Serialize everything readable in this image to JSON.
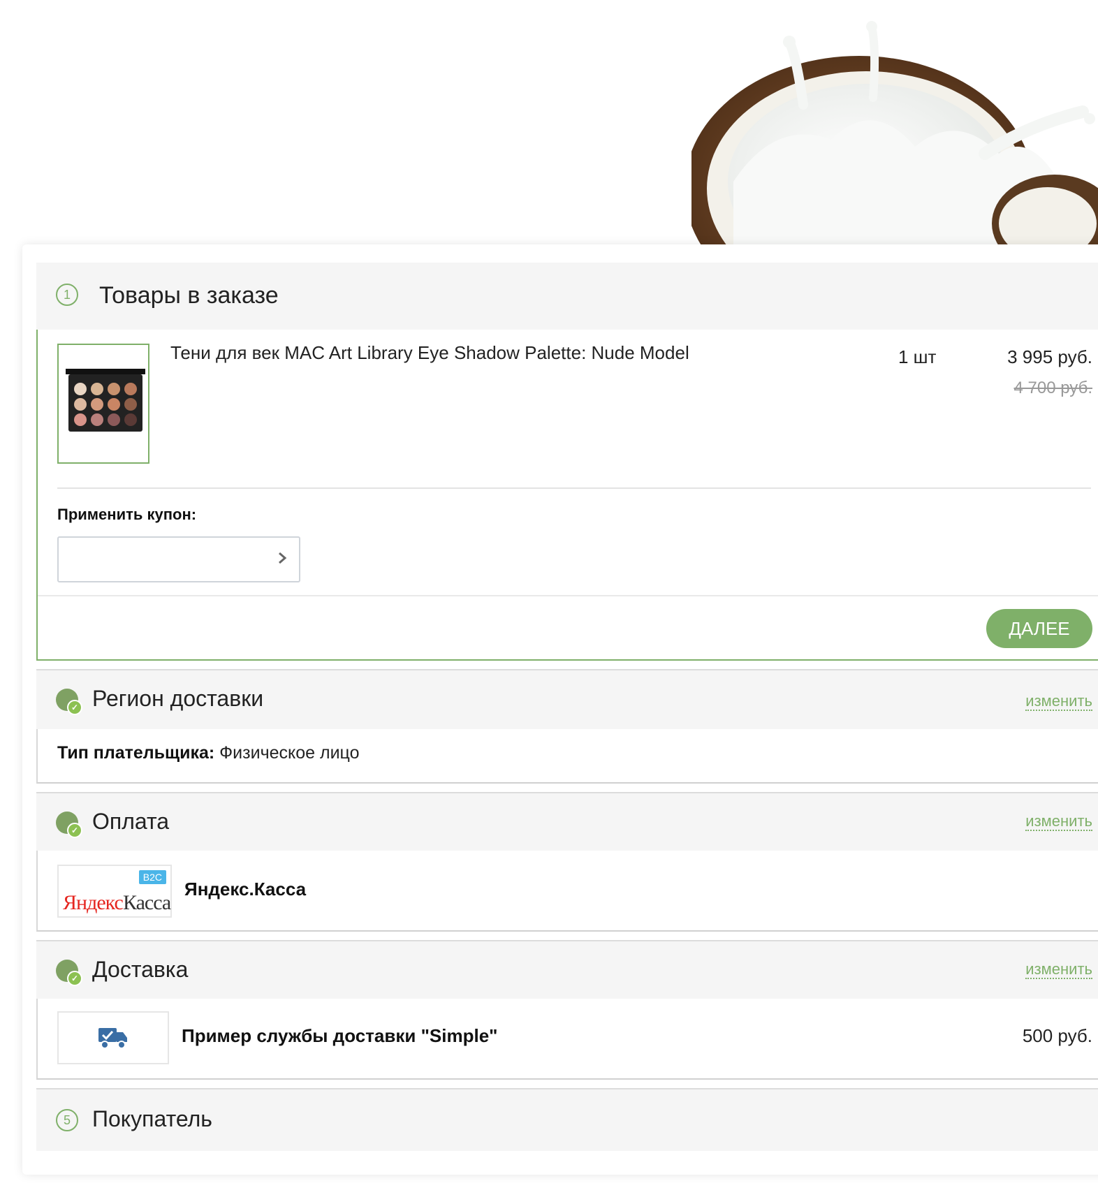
{
  "order_items": {
    "step_number": "1",
    "title": "Товары в заказе",
    "product_name": "Тени для век MAC Art Library Eye Shadow Palette: Nude Model",
    "quantity": "1 шт",
    "price": "3 995 руб.",
    "old_price": "4 700 руб.",
    "coupon_label": "Применить купон:",
    "coupon_value": "",
    "next_button": "ДАЛЕЕ"
  },
  "region": {
    "title": "Регион доставки",
    "change_link": "изменить",
    "payer_label": "Тип плательщика:",
    "payer_value": " Физическое лицо"
  },
  "payment": {
    "title": "Оплата",
    "change_link": "изменить",
    "method_name": "Яндекс.Касса",
    "logo_text_1": "Яндекс",
    "logo_text_2": "Касса",
    "logo_badge": "B2C"
  },
  "delivery": {
    "title": "Доставка",
    "change_link": "изменить",
    "service_name": "Пример службы доставки \"Simple\"",
    "price": "500 руб."
  },
  "buyer": {
    "step_number": "5",
    "title": "Покупатель"
  },
  "colors": {
    "accent": "#7fb069",
    "section_bg": "#f5f5f5",
    "done_dot": "#7fa163",
    "yandex_red": "#e52620",
    "truck_blue": "#3a6ea5"
  }
}
